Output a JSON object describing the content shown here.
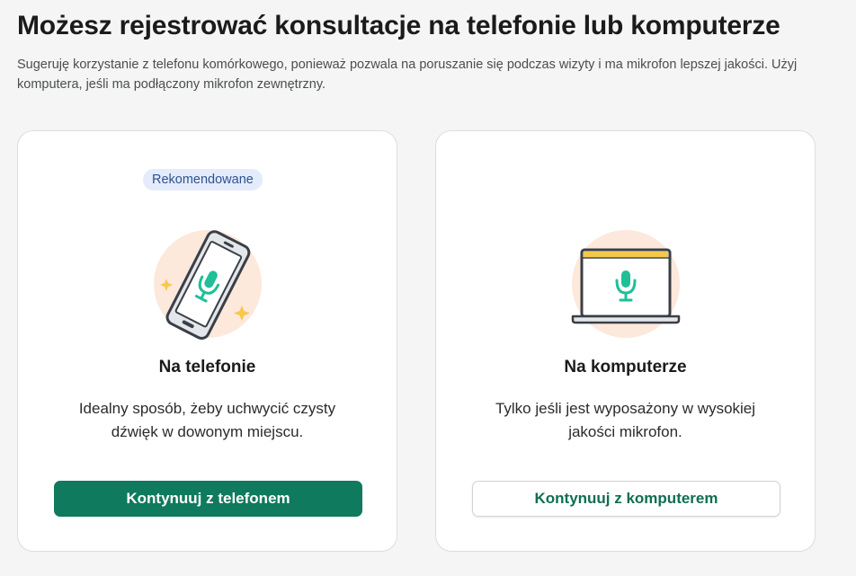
{
  "header": {
    "title": "Możesz rejestrować konsultacje na telefonie lub komputerze",
    "subtitle": "Sugeruję korzystanie z telefonu komórkowego, ponieważ pozwala na poruszanie się podczas wizyty i ma mikrofon lepszej jakości. Użyj komputera, jeśli ma podłączony mikrofon zewnętrzny."
  },
  "options": {
    "phone": {
      "badge": "Rekomendowane",
      "icon": "phone-microphone-icon",
      "title": "Na telefonie",
      "description": "Idealny sposób, żeby uchwycić czysty dźwięk w dowonym miejscu.",
      "button_label": "Kontynuuj z telefonem"
    },
    "computer": {
      "icon": "laptop-microphone-icon",
      "title": "Na komputerze",
      "description": "Tylko jeśli jest wyposażony w wysokiej jakości mikrofon.",
      "button_label": "Kontynuuj z komputerem"
    }
  },
  "colors": {
    "primary": "#0f7a5d",
    "badge_bg": "#e4ebfb",
    "badge_text": "#2d5392",
    "illustration_circle": "#fde8dc",
    "microphone": "#1fbf98",
    "sparkle": "#f6c94c",
    "laptop_bar": "#f3c94a"
  }
}
